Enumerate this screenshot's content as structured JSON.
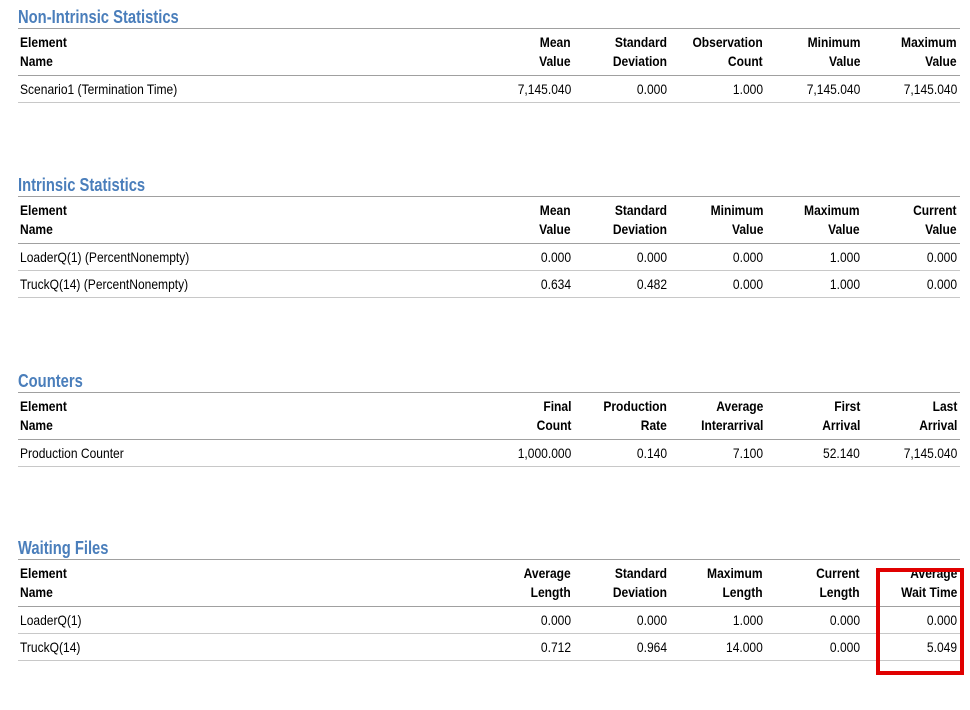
{
  "sections": [
    {
      "title": "Non-Intrinsic Statistics",
      "headers": [
        [
          "Element",
          "Name"
        ],
        [
          "Mean",
          "Value"
        ],
        [
          "Standard",
          "Deviation"
        ],
        [
          "Observation",
          "Count"
        ],
        [
          "Minimum",
          "Value"
        ],
        [
          "Maximum",
          "Value"
        ]
      ],
      "rows": [
        [
          "Scenario1 (Termination Time)",
          "7,145.040",
          "0.000",
          "1.000",
          "7,145.040",
          "7,145.040"
        ]
      ]
    },
    {
      "title": "Intrinsic Statistics",
      "headers": [
        [
          "Element",
          "Name"
        ],
        [
          "Mean",
          "Value"
        ],
        [
          "Standard",
          "Deviation"
        ],
        [
          "Minimum",
          "Value"
        ],
        [
          "Maximum",
          "Value"
        ],
        [
          "Current",
          "Value"
        ]
      ],
      "rows": [
        [
          "LoaderQ(1) (PercentNonempty)",
          "0.000",
          "0.000",
          "0.000",
          "1.000",
          "0.000"
        ],
        [
          "TruckQ(14) (PercentNonempty)",
          "0.634",
          "0.482",
          "0.000",
          "1.000",
          "0.000"
        ]
      ]
    },
    {
      "title": "Counters",
      "headers": [
        [
          "Element",
          "Name"
        ],
        [
          "Final",
          "Count"
        ],
        [
          "Production",
          "Rate"
        ],
        [
          "Average",
          "Interarrival"
        ],
        [
          "First",
          "Arrival"
        ],
        [
          "Last",
          "Arrival"
        ]
      ],
      "rows": [
        [
          "Production Counter",
          "1,000.000",
          "0.140",
          "7.100",
          "52.140",
          "7,145.040"
        ]
      ]
    },
    {
      "title": "Waiting Files",
      "headers": [
        [
          "Element",
          "Name"
        ],
        [
          "Average",
          "Length"
        ],
        [
          "Standard",
          "Deviation"
        ],
        [
          "Maximum",
          "Length"
        ],
        [
          "Current",
          "Length"
        ],
        [
          "Average",
          "Wait Time"
        ]
      ],
      "rows": [
        [
          "LoaderQ(1)",
          "0.000",
          "0.000",
          "1.000",
          "0.000",
          "0.000"
        ],
        [
          "TruckQ(14)",
          "0.712",
          "0.964",
          "14.000",
          "0.000",
          "5.049"
        ]
      ]
    }
  ],
  "highlight_color": "#e00000",
  "title_color": "#4a7ebb"
}
